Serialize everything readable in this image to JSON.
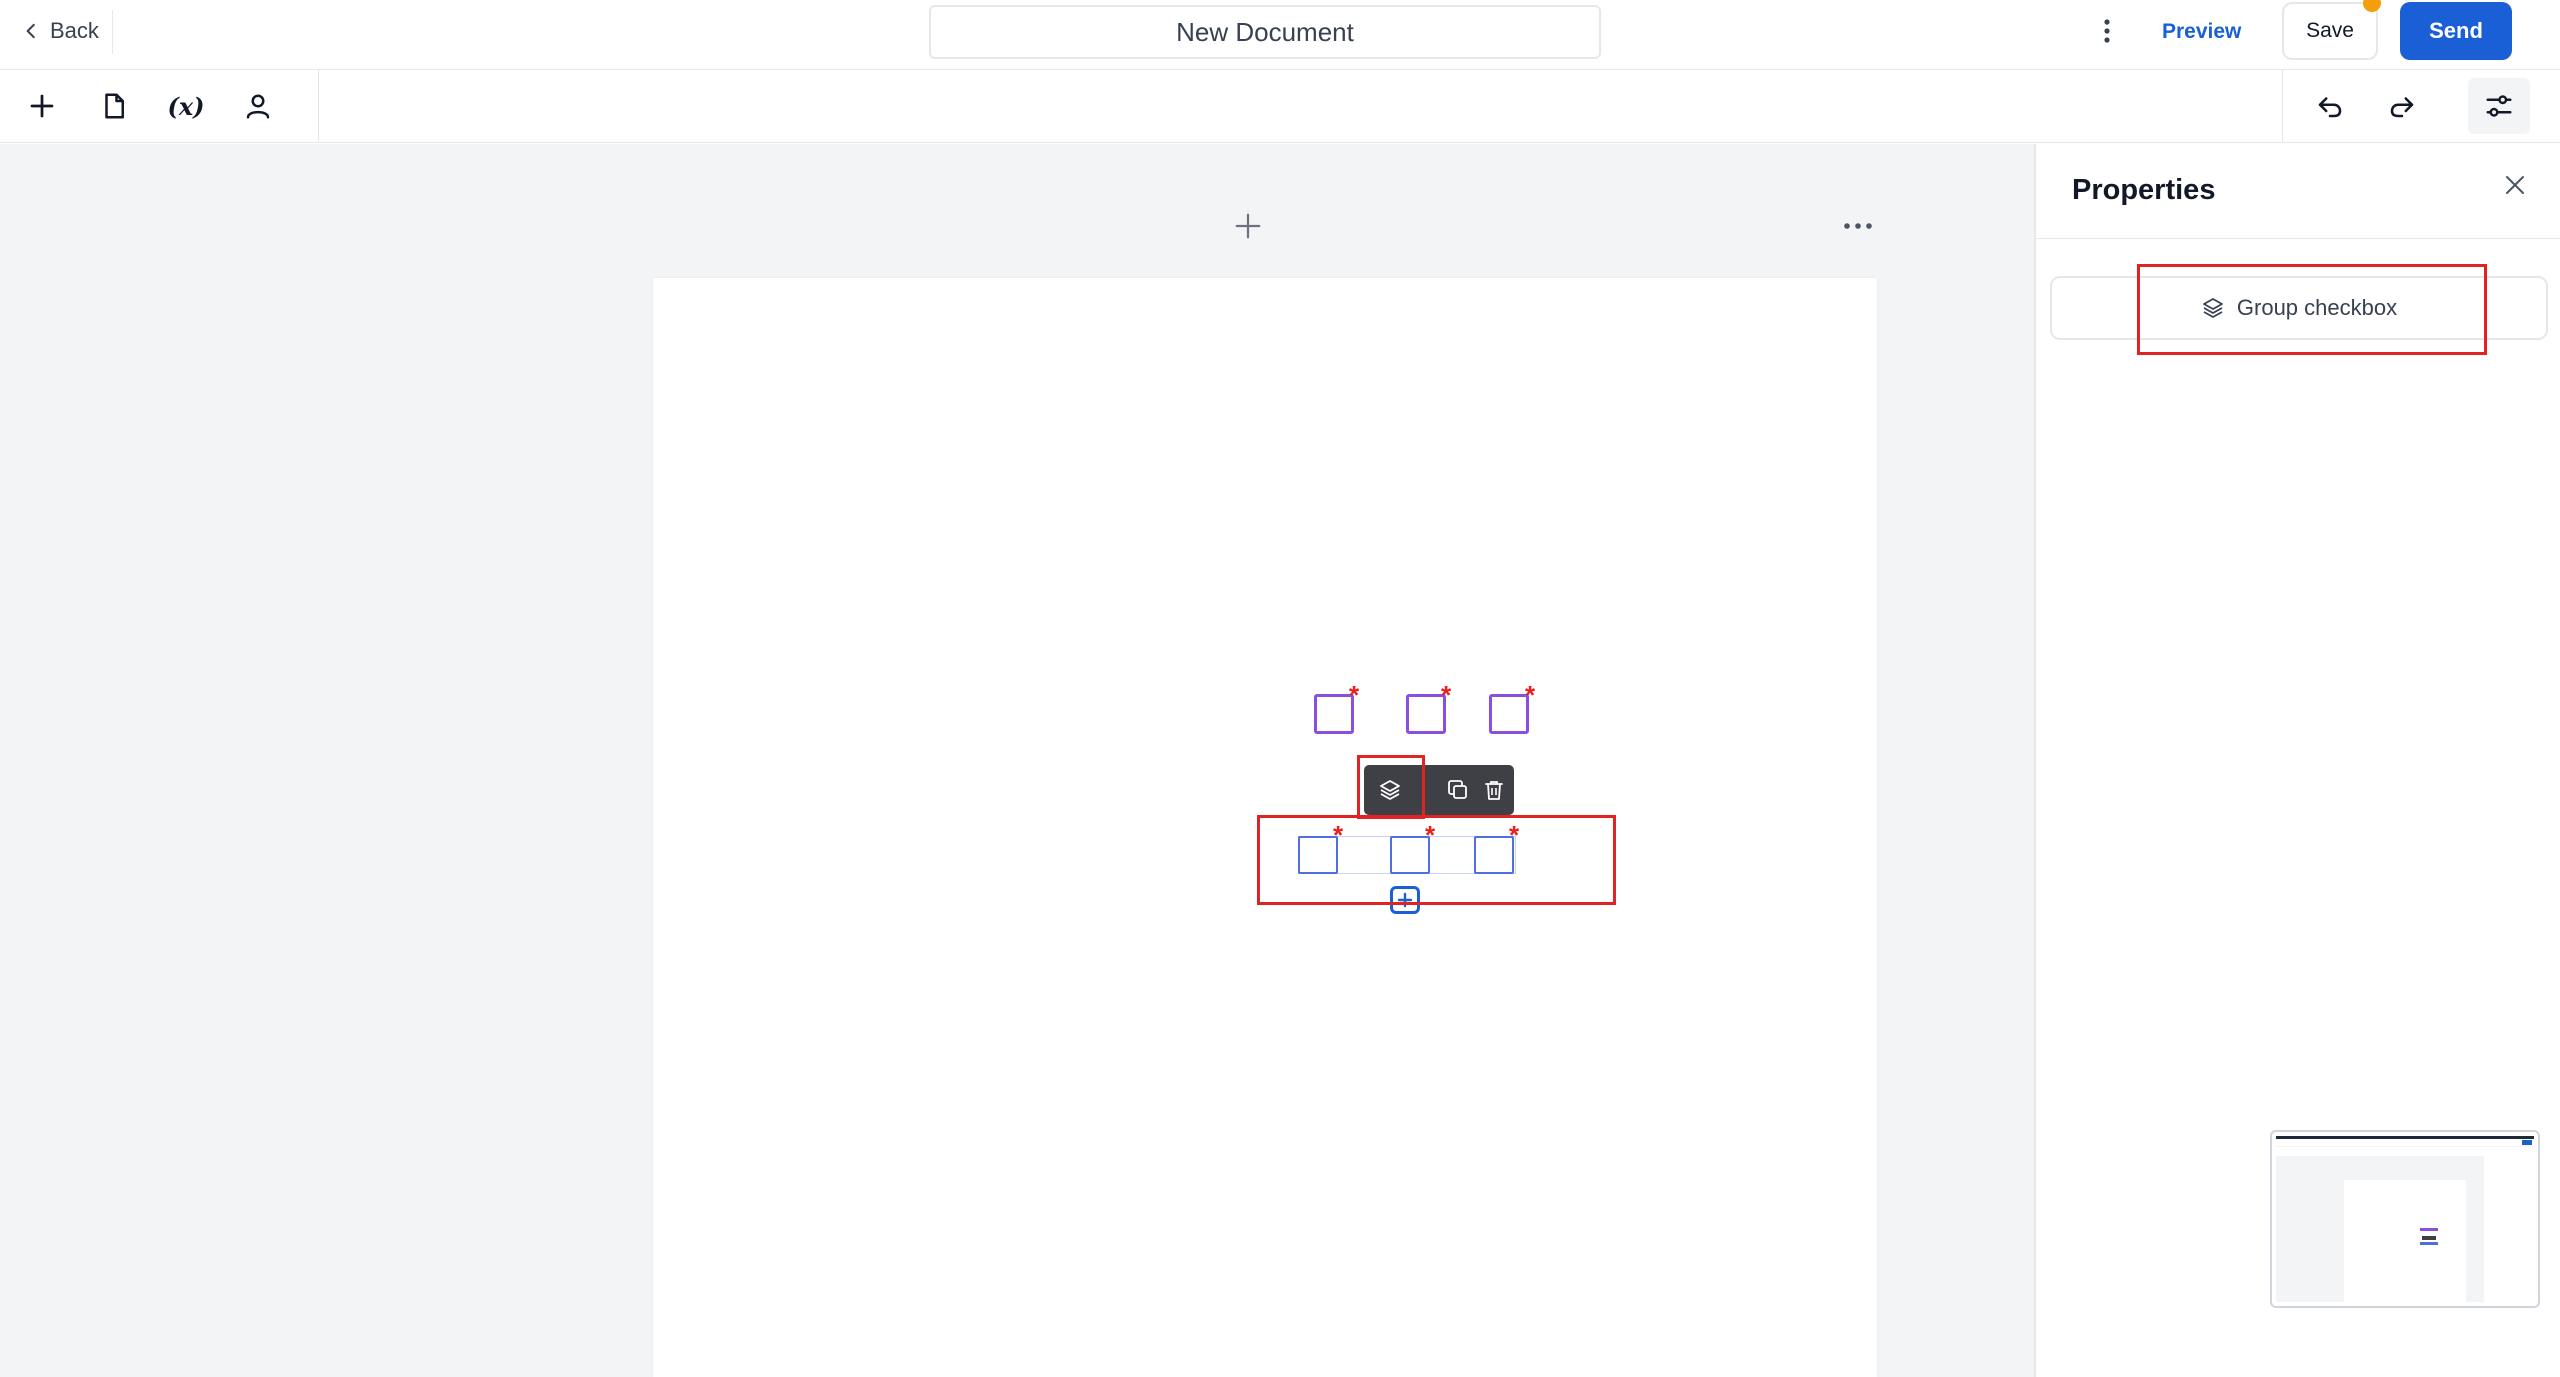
{
  "header": {
    "back_label": "Back",
    "document_title": "New Document",
    "preview_label": "Preview",
    "save_label": "Save",
    "send_label": "Send"
  },
  "toolbar": {
    "variable_label": "(x)"
  },
  "properties": {
    "title": "Properties",
    "group_checkbox_label": "Group checkbox"
  },
  "colors": {
    "primary": "#1a5fd6",
    "checkbox_purple": "#8b4fe0",
    "checkbox_blue": "#4f6fe0",
    "required_red": "#ef1c1c",
    "highlight_red": "#e02424",
    "notification_orange": "#f59e0b"
  },
  "icons": {
    "back": "chevron-left-icon",
    "more": "more-vertical-icon",
    "add": "plus-icon",
    "document": "file-icon",
    "user": "user-icon",
    "undo": "undo-icon",
    "redo": "redo-icon",
    "settings": "sliders-icon",
    "group": "layers-icon",
    "duplicate": "copy-icon",
    "delete": "trash-icon",
    "close": "close-icon"
  }
}
